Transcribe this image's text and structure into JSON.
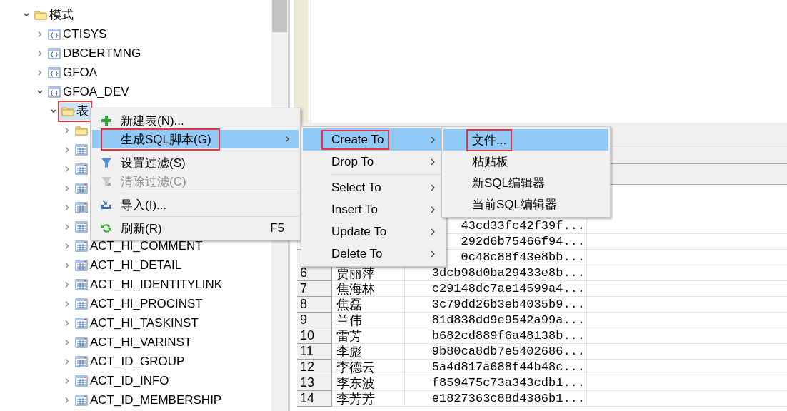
{
  "tree": {
    "items": [
      {
        "name": "模式",
        "kind": "folder",
        "expanded": true,
        "selected": false,
        "children": [
          {
            "name": "CTISYS",
            "kind": "schema",
            "expanded": false,
            "selected": false
          },
          {
            "name": "DBCERTMNG",
            "kind": "schema",
            "expanded": false,
            "selected": false
          },
          {
            "name": "GFOA",
            "kind": "schema",
            "expanded": false,
            "selected": false
          },
          {
            "name": "GFOA_DEV",
            "kind": "schema",
            "expanded": true,
            "selected": false,
            "children": [
              {
                "name": "表",
                "kind": "folder",
                "expanded": true,
                "selected": true,
                "annotated": true,
                "children": [
                  {
                    "kind": "folder",
                    "expanded": false,
                    "selected": false
                  },
                  {
                    "kind": "table",
                    "expanded": false,
                    "selected": false
                  },
                  {
                    "kind": "table",
                    "expanded": false,
                    "selected": false
                  },
                  {
                    "kind": "table",
                    "expanded": false,
                    "selected": false
                  },
                  {
                    "kind": "table",
                    "expanded": false,
                    "selected": false
                  },
                  {
                    "kind": "table",
                    "expanded": false,
                    "selected": false
                  },
                  {
                    "name": "ACT_HI_COMMENT",
                    "kind": "table",
                    "expanded": false,
                    "selected": false
                  },
                  {
                    "name": "ACT_HI_DETAIL",
                    "kind": "table",
                    "expanded": false,
                    "selected": false
                  },
                  {
                    "name": "ACT_HI_IDENTITYLINK",
                    "kind": "table",
                    "expanded": false,
                    "selected": false
                  },
                  {
                    "name": "ACT_HI_PROCINST",
                    "kind": "table",
                    "expanded": false,
                    "selected": false
                  },
                  {
                    "name": "ACT_HI_TASKINST",
                    "kind": "table",
                    "expanded": false,
                    "selected": false
                  },
                  {
                    "name": "ACT_HI_VARINST",
                    "kind": "table",
                    "expanded": false,
                    "selected": false
                  },
                  {
                    "name": "ACT_ID_GROUP",
                    "kind": "table",
                    "expanded": false,
                    "selected": false
                  },
                  {
                    "name": "ACT_ID_INFO",
                    "kind": "table",
                    "expanded": false,
                    "selected": false
                  },
                  {
                    "name": "ACT_ID_MEMBERSHIP",
                    "kind": "table",
                    "expanded": false,
                    "selected": false
                  }
                ]
              }
            ]
          }
        ]
      }
    ]
  },
  "grid": {
    "rows": [
      {
        "hash": "43cd33fc42f39f..."
      },
      {
        "hash": "292d6b75466f94..."
      },
      {
        "hash": "0c48c88f43e8bb..."
      },
      {
        "number": "6",
        "name": "贾丽萍",
        "hash": "3dcb98d0ba29433e8b..."
      },
      {
        "number": "7",
        "name": "焦海林",
        "hash": "c29148dc7ae14599a4..."
      },
      {
        "number": "8",
        "name": "焦磊",
        "hash": "3c79dd26b3eb4035b9..."
      },
      {
        "number": "9",
        "name": "兰伟",
        "hash": "81d838dd9e9542a99a..."
      },
      {
        "number": "10",
        "name": "雷芳",
        "hash": "b682cd889f6a48138b..."
      },
      {
        "number": "11",
        "name": "李彪",
        "hash": "9b80ca8db7e5402686..."
      },
      {
        "number": "12",
        "name": "李德云",
        "hash": "5a4d817a688f44b48c..."
      },
      {
        "number": "13",
        "name": "李东波",
        "hash": "f859475c73a343cdb1..."
      },
      {
        "number": "14",
        "name": "李芳芳",
        "hash": "e1827363c88d4386b1..."
      }
    ]
  },
  "context_menu": {
    "items": [
      {
        "kind": "item",
        "label": "新建表(N)...",
        "selected": false,
        "disabled": false
      },
      {
        "kind": "item",
        "label": "生成SQL脚本(G)",
        "selected": true,
        "disabled": false,
        "submenu": true,
        "annotated": true
      },
      {
        "kind": "separator"
      },
      {
        "kind": "item",
        "label": "设置过滤(S)",
        "selected": false,
        "disabled": false
      },
      {
        "kind": "item",
        "label": "清除过滤(C)",
        "selected": false,
        "disabled": true
      },
      {
        "kind": "separator"
      },
      {
        "kind": "item",
        "label": "导入(I)...",
        "selected": false,
        "disabled": false
      },
      {
        "kind": "separator"
      },
      {
        "kind": "item",
        "label": "刷新(R)",
        "shortcut": "F5",
        "selected": false,
        "disabled": false
      }
    ]
  },
  "script_menu": {
    "items": [
      {
        "kind": "item",
        "label": "Create To",
        "selected": true,
        "submenu": true,
        "annotated": true
      },
      {
        "kind": "item",
        "label": "Drop To",
        "selected": false,
        "submenu": true
      },
      {
        "kind": "separator"
      },
      {
        "kind": "item",
        "label": "Select To",
        "selected": false,
        "submenu": true
      },
      {
        "kind": "item",
        "label": "Insert To",
        "selected": false,
        "submenu": true
      },
      {
        "kind": "item",
        "label": "Update To",
        "selected": false,
        "submenu": true
      },
      {
        "kind": "item",
        "label": "Delete To",
        "selected": false,
        "submenu": true
      }
    ]
  },
  "target_menu": {
    "items": [
      {
        "kind": "item",
        "label": "文件...",
        "selected": true,
        "annotated": true
      },
      {
        "kind": "item",
        "label": "粘贴板",
        "selected": false
      },
      {
        "kind": "item",
        "label": "新SQL编辑器",
        "selected": false
      },
      {
        "kind": "item",
        "label": "当前SQL编辑器",
        "selected": false
      }
    ]
  }
}
